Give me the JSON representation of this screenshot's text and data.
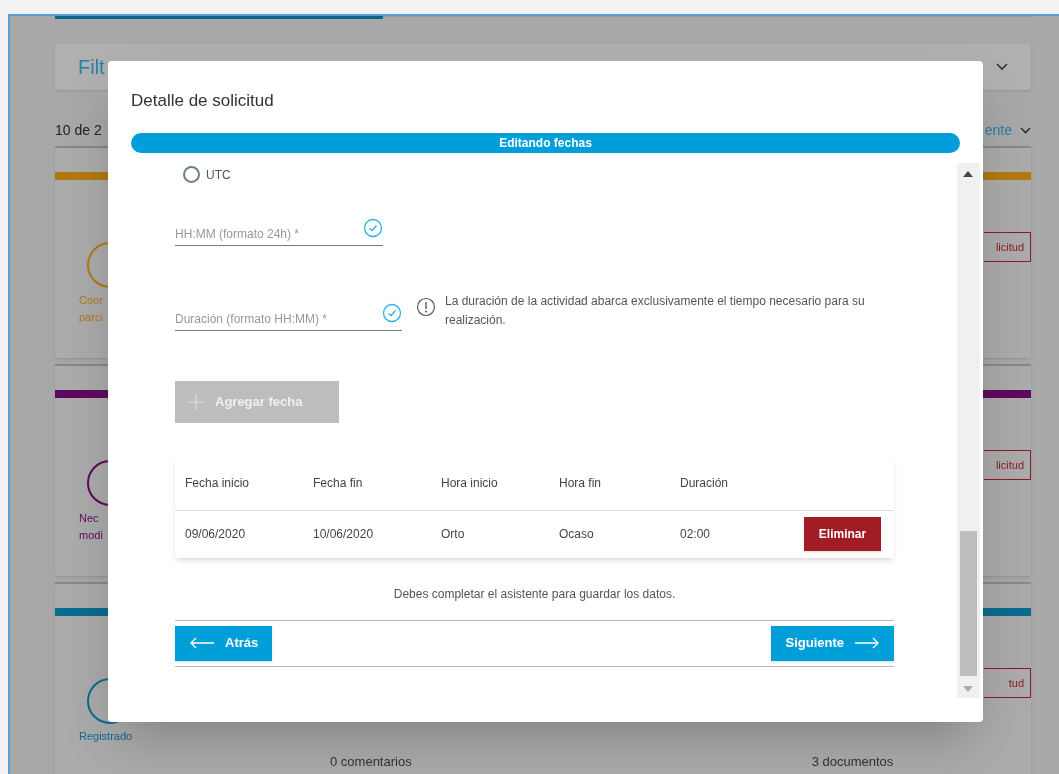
{
  "background": {
    "filter_title": "Filt",
    "count": "10 de 2",
    "sort": "ente",
    "cards": [
      {
        "status_lines": [
          "Coor",
          "parci"
        ],
        "color": "#b07a10",
        "action": "licitud"
      },
      {
        "status_lines": [
          "Nec",
          "modi"
        ],
        "color": "#5e0a5e",
        "action": "licitud"
      },
      {
        "status_lines": [
          "Registrado"
        ],
        "color": "#0a6c90",
        "action": "tud"
      }
    ],
    "footer": [
      "0 comentarios",
      "3 documentos"
    ]
  },
  "dialog": {
    "title": "Detalle de solicitud",
    "step": "Editando fechas",
    "timezone_option": {
      "label": "UTC",
      "selected": false
    },
    "fields": [
      {
        "placeholder": "HH:MM (formato 24h) *"
      },
      {
        "placeholder": "Duración (formato HH:MM) *",
        "hint": "La duración de la actividad abarca exclusivamente el tiempo necesario para su realización."
      }
    ],
    "add_button": {
      "label": "Agregar fecha",
      "disabled": true
    },
    "table": {
      "columns": [
        "Fecha inicio",
        "Fecha fin",
        "Hora inicio",
        "Hora fin",
        "Duración"
      ],
      "rows": [
        {
          "cells": [
            "09/06/2020",
            "10/06/2020",
            "Orto",
            "Ocaso",
            "02:00"
          ],
          "action": "Eliminar"
        }
      ]
    },
    "notice": "Debes completar el asistente para guardar los datos.",
    "buttons": [
      {
        "label": "Atrás",
        "kind": "back"
      },
      {
        "label": "Siguiente",
        "kind": "next"
      }
    ]
  }
}
